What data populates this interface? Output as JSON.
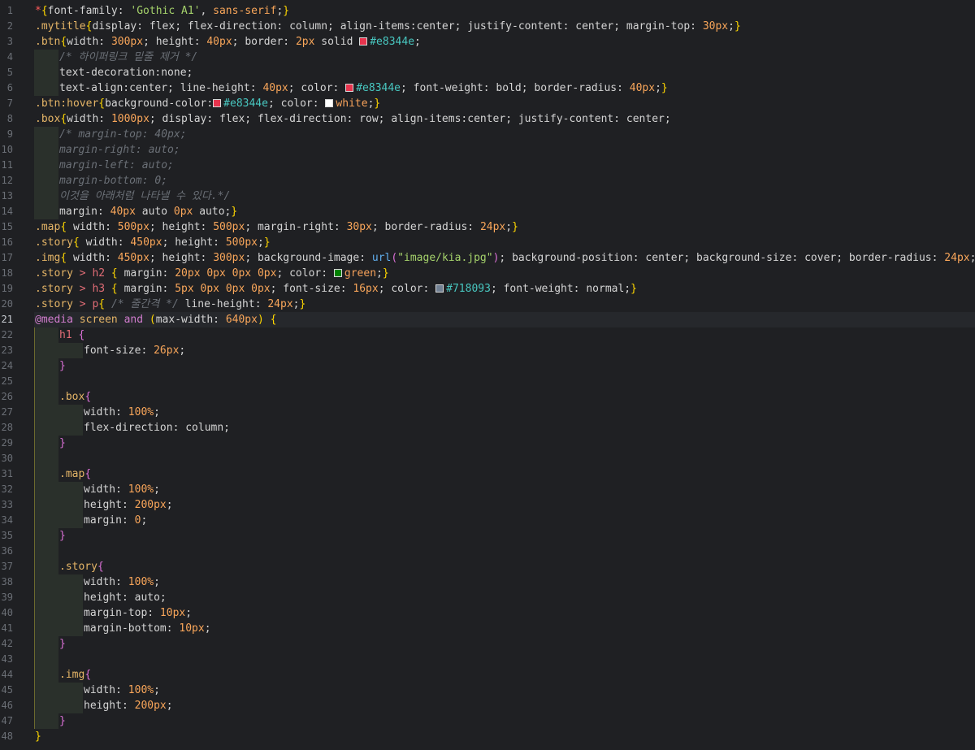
{
  "editor": {
    "active_line": 21,
    "colors": {
      "background": "#1f2023",
      "current_line": "#26282c",
      "indent_guide": "#2a302b"
    },
    "lines": [
      {
        "n": 1,
        "indent": 0,
        "tokens": [
          {
            "t": "*",
            "c": "c-star"
          },
          {
            "t": "{",
            "c": "c-br1"
          },
          {
            "t": "font-family: ",
            "c": "c-prop"
          },
          {
            "t": "'Gothic A1'",
            "c": "c-str"
          },
          {
            "t": ", ",
            "c": "c-prop"
          },
          {
            "t": "sans-serif",
            "c": "c-num"
          },
          {
            "t": ";",
            "c": "c-prop"
          },
          {
            "t": "}",
            "c": "c-br1"
          }
        ]
      },
      {
        "n": 2,
        "indent": 0,
        "tokens": [
          {
            "t": ".mytitle",
            "c": "c-cls"
          },
          {
            "t": "{",
            "c": "c-br1"
          },
          {
            "t": "display: flex; flex-direction: column; align-items:center; justify-content: center; margin-top: ",
            "c": "c-prop"
          },
          {
            "t": "30px",
            "c": "c-num"
          },
          {
            "t": ";",
            "c": "c-prop"
          },
          {
            "t": "}",
            "c": "c-br1"
          }
        ]
      },
      {
        "n": 3,
        "indent": 0,
        "tokens": [
          {
            "t": ".btn",
            "c": "c-cls"
          },
          {
            "t": "{",
            "c": "c-br1"
          },
          {
            "t": "width: ",
            "c": "c-prop"
          },
          {
            "t": "300px",
            "c": "c-num"
          },
          {
            "t": "; height: ",
            "c": "c-prop"
          },
          {
            "t": "40px",
            "c": "c-num"
          },
          {
            "t": "; border: ",
            "c": "c-prop"
          },
          {
            "t": "2px",
            "c": "c-num"
          },
          {
            "t": " solid ",
            "c": "c-prop"
          },
          {
            "sw": "#e8344e"
          },
          {
            "t": "#e8344e",
            "c": "c-hex"
          },
          {
            "t": ";",
            "c": "c-prop"
          }
        ]
      },
      {
        "n": 4,
        "indent": 1,
        "tokens": [
          {
            "t": "/* 하이퍼링크 밑줄 제거 */",
            "c": "c-com"
          }
        ]
      },
      {
        "n": 5,
        "indent": 1,
        "tokens": [
          {
            "t": "text-decoration:none;",
            "c": "c-prop"
          }
        ]
      },
      {
        "n": 6,
        "indent": 1,
        "tokens": [
          {
            "t": "text-align:center; line-height: ",
            "c": "c-prop"
          },
          {
            "t": "40px",
            "c": "c-num"
          },
          {
            "t": "; color: ",
            "c": "c-prop"
          },
          {
            "sw": "#e8344e"
          },
          {
            "t": "#e8344e",
            "c": "c-hex"
          },
          {
            "t": "; font-weight: bold; border-radius: ",
            "c": "c-prop"
          },
          {
            "t": "40px",
            "c": "c-num"
          },
          {
            "t": ";",
            "c": "c-prop"
          },
          {
            "t": "}",
            "c": "c-br1"
          }
        ]
      },
      {
        "n": 7,
        "indent": 0,
        "tokens": [
          {
            "t": ".btn:hover",
            "c": "c-cls"
          },
          {
            "t": "{",
            "c": "c-br1"
          },
          {
            "t": "background-color:",
            "c": "c-prop"
          },
          {
            "sw": "#e8344e"
          },
          {
            "t": "#e8344e",
            "c": "c-hex"
          },
          {
            "t": "; color: ",
            "c": "c-prop"
          },
          {
            "sw": "#ffffff"
          },
          {
            "t": "white",
            "c": "c-white"
          },
          {
            "t": ";",
            "c": "c-prop"
          },
          {
            "t": "}",
            "c": "c-br1"
          }
        ]
      },
      {
        "n": 8,
        "indent": 0,
        "tokens": [
          {
            "t": ".box",
            "c": "c-cls"
          },
          {
            "t": "{",
            "c": "c-br1"
          },
          {
            "t": "width: ",
            "c": "c-prop"
          },
          {
            "t": "1000px",
            "c": "c-num"
          },
          {
            "t": "; display: flex; flex-direction: row; align-items:center; justify-content: center;",
            "c": "c-prop"
          }
        ]
      },
      {
        "n": 9,
        "indent": 1,
        "tokens": [
          {
            "t": "/* margin-top: 40px;",
            "c": "c-com"
          }
        ]
      },
      {
        "n": 10,
        "indent": 1,
        "tokens": [
          {
            "t": "margin-right: auto;",
            "c": "c-com"
          }
        ]
      },
      {
        "n": 11,
        "indent": 1,
        "tokens": [
          {
            "t": "margin-left: auto;",
            "c": "c-com"
          }
        ]
      },
      {
        "n": 12,
        "indent": 1,
        "tokens": [
          {
            "t": "margin-bottom: 0;",
            "c": "c-com"
          }
        ]
      },
      {
        "n": 13,
        "indent": 1,
        "tokens": [
          {
            "t": "이것을 아래처럼 나타낼 수 있다.*/",
            "c": "c-com"
          }
        ]
      },
      {
        "n": 14,
        "indent": 1,
        "tokens": [
          {
            "t": "margin: ",
            "c": "c-prop"
          },
          {
            "t": "40px",
            "c": "c-num"
          },
          {
            "t": " auto ",
            "c": "c-prop"
          },
          {
            "t": "0px",
            "c": "c-num"
          },
          {
            "t": " auto;",
            "c": "c-prop"
          },
          {
            "t": "}",
            "c": "c-br1"
          }
        ]
      },
      {
        "n": 15,
        "indent": 0,
        "tokens": [
          {
            "t": ".map",
            "c": "c-cls"
          },
          {
            "t": "{",
            "c": "c-br1"
          },
          {
            "t": " width: ",
            "c": "c-prop"
          },
          {
            "t": "500px",
            "c": "c-num"
          },
          {
            "t": "; height: ",
            "c": "c-prop"
          },
          {
            "t": "500px",
            "c": "c-num"
          },
          {
            "t": "; margin-right: ",
            "c": "c-prop"
          },
          {
            "t": "30px",
            "c": "c-num"
          },
          {
            "t": "; border-radius: ",
            "c": "c-prop"
          },
          {
            "t": "24px",
            "c": "c-num"
          },
          {
            "t": ";",
            "c": "c-prop"
          },
          {
            "t": "}",
            "c": "c-br1"
          }
        ]
      },
      {
        "n": 16,
        "indent": 0,
        "tokens": [
          {
            "t": ".story",
            "c": "c-cls"
          },
          {
            "t": "{",
            "c": "c-br1"
          },
          {
            "t": " width: ",
            "c": "c-prop"
          },
          {
            "t": "450px",
            "c": "c-num"
          },
          {
            "t": "; height: ",
            "c": "c-prop"
          },
          {
            "t": "500px",
            "c": "c-num"
          },
          {
            "t": ";",
            "c": "c-prop"
          },
          {
            "t": "}",
            "c": "c-br1"
          }
        ]
      },
      {
        "n": 17,
        "indent": 0,
        "tokens": [
          {
            "t": ".img",
            "c": "c-cls"
          },
          {
            "t": "{",
            "c": "c-br1"
          },
          {
            "t": " width: ",
            "c": "c-prop"
          },
          {
            "t": "450px",
            "c": "c-num"
          },
          {
            "t": "; height: ",
            "c": "c-prop"
          },
          {
            "t": "300px",
            "c": "c-num"
          },
          {
            "t": "; background-image: ",
            "c": "c-prop"
          },
          {
            "t": "url",
            "c": "c-fn"
          },
          {
            "t": "(",
            "c": "c-br2"
          },
          {
            "t": "\"image/kia.jpg\"",
            "c": "c-str"
          },
          {
            "t": ")",
            "c": "c-br2"
          },
          {
            "t": "; background-position: center; background-size: cover; border-radius: ",
            "c": "c-prop"
          },
          {
            "t": "24px",
            "c": "c-num"
          },
          {
            "t": ";",
            "c": "c-prop"
          },
          {
            "t": "}",
            "c": "c-br1"
          }
        ]
      },
      {
        "n": 18,
        "indent": 0,
        "tokens": [
          {
            "t": ".story",
            "c": "c-cls"
          },
          {
            "t": " > ",
            "c": "c-tag"
          },
          {
            "t": "h2",
            "c": "c-tag"
          },
          {
            "t": " { ",
            "c": "c-br1"
          },
          {
            "t": "margin: ",
            "c": "c-prop"
          },
          {
            "t": "20px 0px 0px 0px",
            "c": "c-num"
          },
          {
            "t": "; color: ",
            "c": "c-prop"
          },
          {
            "sw": "#008000"
          },
          {
            "t": "green",
            "c": "c-white"
          },
          {
            "t": ";",
            "c": "c-prop"
          },
          {
            "t": "}",
            "c": "c-br1"
          }
        ]
      },
      {
        "n": 19,
        "indent": 0,
        "tokens": [
          {
            "t": ".story",
            "c": "c-cls"
          },
          {
            "t": " > ",
            "c": "c-tag"
          },
          {
            "t": "h3",
            "c": "c-tag"
          },
          {
            "t": " { ",
            "c": "c-br1"
          },
          {
            "t": "margin: ",
            "c": "c-prop"
          },
          {
            "t": "5px 0px 0px 0px",
            "c": "c-num"
          },
          {
            "t": "; font-size: ",
            "c": "c-prop"
          },
          {
            "t": "16px",
            "c": "c-num"
          },
          {
            "t": "; color: ",
            "c": "c-prop"
          },
          {
            "sw": "#718093"
          },
          {
            "t": "#718093",
            "c": "c-hex"
          },
          {
            "t": "; font-weight: normal;",
            "c": "c-prop"
          },
          {
            "t": "}",
            "c": "c-br1"
          }
        ]
      },
      {
        "n": 20,
        "indent": 0,
        "tokens": [
          {
            "t": ".story",
            "c": "c-cls"
          },
          {
            "t": " > ",
            "c": "c-tag"
          },
          {
            "t": "p",
            "c": "c-tag"
          },
          {
            "t": "{ ",
            "c": "c-br1"
          },
          {
            "t": "/* 줄간격 */",
            "c": "c-com"
          },
          {
            "t": " line-height: ",
            "c": "c-prop"
          },
          {
            "t": "24px",
            "c": "c-num"
          },
          {
            "t": ";",
            "c": "c-prop"
          },
          {
            "t": "}",
            "c": "c-br1"
          }
        ]
      },
      {
        "n": 21,
        "indent": 0,
        "tokens": [
          {
            "t": "@media",
            "c": "c-kw"
          },
          {
            "t": " screen ",
            "c": "c-cls"
          },
          {
            "t": "and",
            "c": "c-kw"
          },
          {
            "t": " ",
            "c": "c-prop"
          },
          {
            "t": "(",
            "c": "c-br1"
          },
          {
            "t": "max-width: ",
            "c": "c-prop"
          },
          {
            "t": "640px",
            "c": "c-num"
          },
          {
            "t": ")",
            "c": "c-br1"
          },
          {
            "t": " {",
            "c": "c-br1"
          }
        ]
      },
      {
        "n": 22,
        "indent": 1,
        "tokens": [
          {
            "t": "h1",
            "c": "c-tag"
          },
          {
            "t": " {",
            "c": "c-br2"
          }
        ]
      },
      {
        "n": 23,
        "indent": 2,
        "tokens": [
          {
            "t": "font-size: ",
            "c": "c-prop"
          },
          {
            "t": "26px",
            "c": "c-num"
          },
          {
            "t": ";",
            "c": "c-prop"
          }
        ]
      },
      {
        "n": 24,
        "indent": 1,
        "tokens": [
          {
            "t": "}",
            "c": "c-br2"
          }
        ]
      },
      {
        "n": 25,
        "indent": 1,
        "tokens": []
      },
      {
        "n": 26,
        "indent": 1,
        "tokens": [
          {
            "t": ".box",
            "c": "c-cls"
          },
          {
            "t": "{",
            "c": "c-br2"
          }
        ]
      },
      {
        "n": 27,
        "indent": 2,
        "tokens": [
          {
            "t": "width: ",
            "c": "c-prop"
          },
          {
            "t": "100%",
            "c": "c-num"
          },
          {
            "t": ";",
            "c": "c-prop"
          }
        ]
      },
      {
        "n": 28,
        "indent": 2,
        "tokens": [
          {
            "t": "flex-direction: column;",
            "c": "c-prop"
          }
        ]
      },
      {
        "n": 29,
        "indent": 1,
        "tokens": [
          {
            "t": "}",
            "c": "c-br2"
          }
        ]
      },
      {
        "n": 30,
        "indent": 1,
        "tokens": []
      },
      {
        "n": 31,
        "indent": 1,
        "tokens": [
          {
            "t": ".map",
            "c": "c-cls"
          },
          {
            "t": "{",
            "c": "c-br2"
          }
        ]
      },
      {
        "n": 32,
        "indent": 2,
        "tokens": [
          {
            "t": "width: ",
            "c": "c-prop"
          },
          {
            "t": "100%",
            "c": "c-num"
          },
          {
            "t": ";",
            "c": "c-prop"
          }
        ]
      },
      {
        "n": 33,
        "indent": 2,
        "tokens": [
          {
            "t": "height: ",
            "c": "c-prop"
          },
          {
            "t": "200px",
            "c": "c-num"
          },
          {
            "t": ";",
            "c": "c-prop"
          }
        ]
      },
      {
        "n": 34,
        "indent": 2,
        "tokens": [
          {
            "t": "margin: ",
            "c": "c-prop"
          },
          {
            "t": "0",
            "c": "c-num"
          },
          {
            "t": ";",
            "c": "c-prop"
          }
        ]
      },
      {
        "n": 35,
        "indent": 1,
        "tokens": [
          {
            "t": "}",
            "c": "c-br2"
          }
        ]
      },
      {
        "n": 36,
        "indent": 1,
        "tokens": []
      },
      {
        "n": 37,
        "indent": 1,
        "tokens": [
          {
            "t": ".story",
            "c": "c-cls"
          },
          {
            "t": "{",
            "c": "c-br2"
          }
        ]
      },
      {
        "n": 38,
        "indent": 2,
        "tokens": [
          {
            "t": "width: ",
            "c": "c-prop"
          },
          {
            "t": "100%",
            "c": "c-num"
          },
          {
            "t": ";",
            "c": "c-prop"
          }
        ]
      },
      {
        "n": 39,
        "indent": 2,
        "tokens": [
          {
            "t": "height: auto;",
            "c": "c-prop"
          }
        ]
      },
      {
        "n": 40,
        "indent": 2,
        "tokens": [
          {
            "t": "margin-top: ",
            "c": "c-prop"
          },
          {
            "t": "10px",
            "c": "c-num"
          },
          {
            "t": ";",
            "c": "c-prop"
          }
        ]
      },
      {
        "n": 41,
        "indent": 2,
        "tokens": [
          {
            "t": "margin-bottom: ",
            "c": "c-prop"
          },
          {
            "t": "10px",
            "c": "c-num"
          },
          {
            "t": ";",
            "c": "c-prop"
          }
        ]
      },
      {
        "n": 42,
        "indent": 1,
        "tokens": [
          {
            "t": "}",
            "c": "c-br2"
          }
        ]
      },
      {
        "n": 43,
        "indent": 1,
        "tokens": []
      },
      {
        "n": 44,
        "indent": 1,
        "tokens": [
          {
            "t": ".img",
            "c": "c-cls"
          },
          {
            "t": "{",
            "c": "c-br2"
          }
        ]
      },
      {
        "n": 45,
        "indent": 2,
        "tokens": [
          {
            "t": "width: ",
            "c": "c-prop"
          },
          {
            "t": "100%",
            "c": "c-num"
          },
          {
            "t": ";",
            "c": "c-prop"
          }
        ]
      },
      {
        "n": 46,
        "indent": 2,
        "tokens": [
          {
            "t": "height: ",
            "c": "c-prop"
          },
          {
            "t": "200px",
            "c": "c-num"
          },
          {
            "t": ";",
            "c": "c-prop"
          }
        ]
      },
      {
        "n": 47,
        "indent": 1,
        "tokens": [
          {
            "t": "}",
            "c": "c-br2"
          }
        ]
      },
      {
        "n": 48,
        "indent": 0,
        "tokens": [
          {
            "t": "}",
            "c": "c-br1"
          }
        ]
      }
    ]
  }
}
